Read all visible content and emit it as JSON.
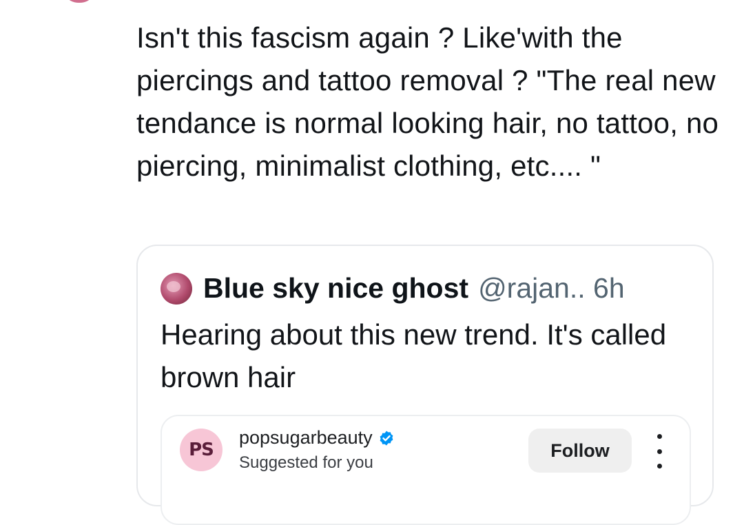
{
  "post": {
    "text": "Isn't this fascism again ? Like'with the piercings and tattoo removal ? \"The real new tendance is normal looking hair, no tattoo, no piercing, minimalist clothing, etc.... \""
  },
  "quoted_post": {
    "author_name": "Blue sky nice ghost",
    "author_handle_time": "@rajan.. 6h",
    "text": "Hearing about this new trend. It's called brown hair"
  },
  "embed": {
    "logo_text": "PS",
    "account_name": "popsugarbeauty",
    "subtitle": "Suggested for you",
    "follow_label": "Follow",
    "verified_color": "#0095f6"
  },
  "icons": {
    "verified": "verified-badge-icon",
    "more": "more-vertical-icon"
  }
}
